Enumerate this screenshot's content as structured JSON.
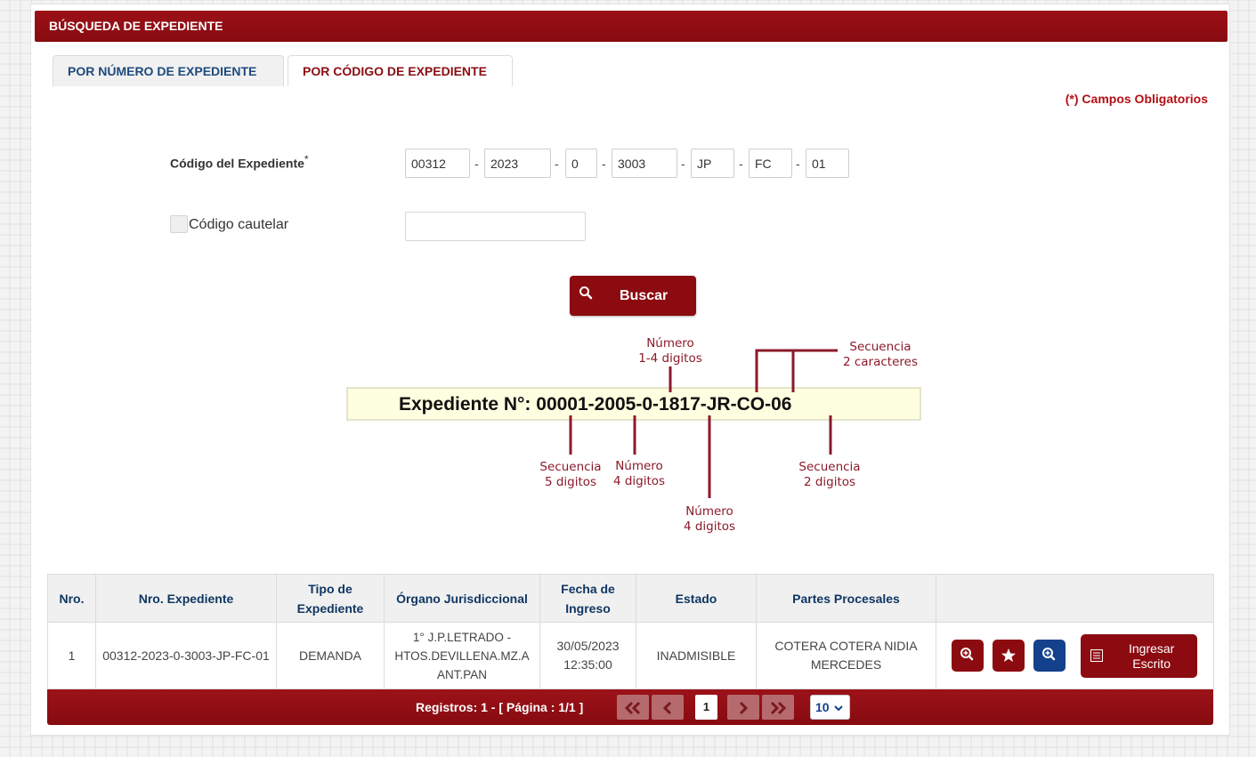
{
  "header": {
    "title": "BÚSQUEDA DE EXPEDIENTE"
  },
  "tabs": [
    {
      "label": "POR NÚMERO DE EXPEDIENTE"
    },
    {
      "label": "POR CÓDIGO DE EXPEDIENTE"
    }
  ],
  "required_note": "(*) Campos Obligatorios",
  "form": {
    "code_label": "Código del Expediente",
    "required_mark": "*",
    "code_parts": [
      "00312",
      "2023",
      "0",
      "3003",
      "JP",
      "FC",
      "01"
    ],
    "separator": "-",
    "cautelar_label": "Código cautelar",
    "cautelar_value": ""
  },
  "search_button": {
    "label": "Buscar",
    "icon": "search-icon"
  },
  "diagram": {
    "example": "Expediente N°: 00001-2005-0-1817-JR-CO-06",
    "top_number_1": "Número",
    "top_number_2": "1-4 digitos",
    "top_seq_1": "Secuencia",
    "top_seq_2": "2 caracteres",
    "seq5_1": "Secuencia",
    "seq5_2": "5 digitos",
    "num4_1": "Número",
    "num4_2": "4 digitos",
    "num4b_1": "Número",
    "num4b_2": "4 digitos",
    "seq2_1": "Secuencia",
    "seq2_2": "2 digitos"
  },
  "table": {
    "headers": [
      "Nro.",
      "Nro. Expediente",
      "Tipo de Expediente",
      "Órgano Jurisdiccional",
      "Fecha de Ingreso",
      "Estado",
      "Partes Procesales",
      ""
    ],
    "rows": [
      {
        "nro": "1",
        "expediente": "00312-2023-0-3003-JP-FC-01",
        "tipo": "DEMANDA",
        "organo": "1° J.P.LETRADO - HTOS.DEVILLENA.MZ.A ANT.PAN",
        "fecha": "30/05/2023 12:35:00",
        "estado": "INADMISIBLE",
        "partes": "COTERA COTERA NIDIA MERCEDES",
        "escrito_label": "Ingresar Escrito"
      }
    ]
  },
  "pager": {
    "registros": "Registros: 1 - [ Página : 1/1 ]",
    "first": "«",
    "prev": "‹",
    "current": "1",
    "next": "›",
    "last": "»",
    "page_size": "10"
  },
  "colors": {
    "brand": "#8c0b10",
    "blue": "#14418b",
    "diagram": "#8b1a2a",
    "diagram_box": "#fefee0"
  }
}
